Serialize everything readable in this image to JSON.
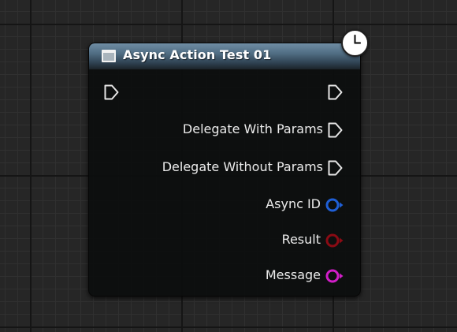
{
  "node": {
    "title": "Async Action Test 01",
    "header_icon": "function-node-icon",
    "latent_icon": "clock-icon"
  },
  "exec_in": {
    "icon": "exec-pin-icon"
  },
  "exec_out": {
    "icon": "exec-pin-icon"
  },
  "output_pins": [
    {
      "label": "Delegate With Params",
      "type": "exec",
      "color": "#e6e6e6"
    },
    {
      "label": "Delegate Without Params",
      "type": "exec",
      "color": "#e6e6e6"
    },
    {
      "label": "Async ID",
      "type": "data",
      "color": "#1f5fd6"
    },
    {
      "label": "Result",
      "type": "data",
      "color": "#8a0b14"
    },
    {
      "label": "Message",
      "type": "data",
      "color": "#d11ec8"
    }
  ],
  "colors": {
    "canvas": "#262626",
    "node_body": "#0c0e0e",
    "header": "#4f6c82"
  }
}
